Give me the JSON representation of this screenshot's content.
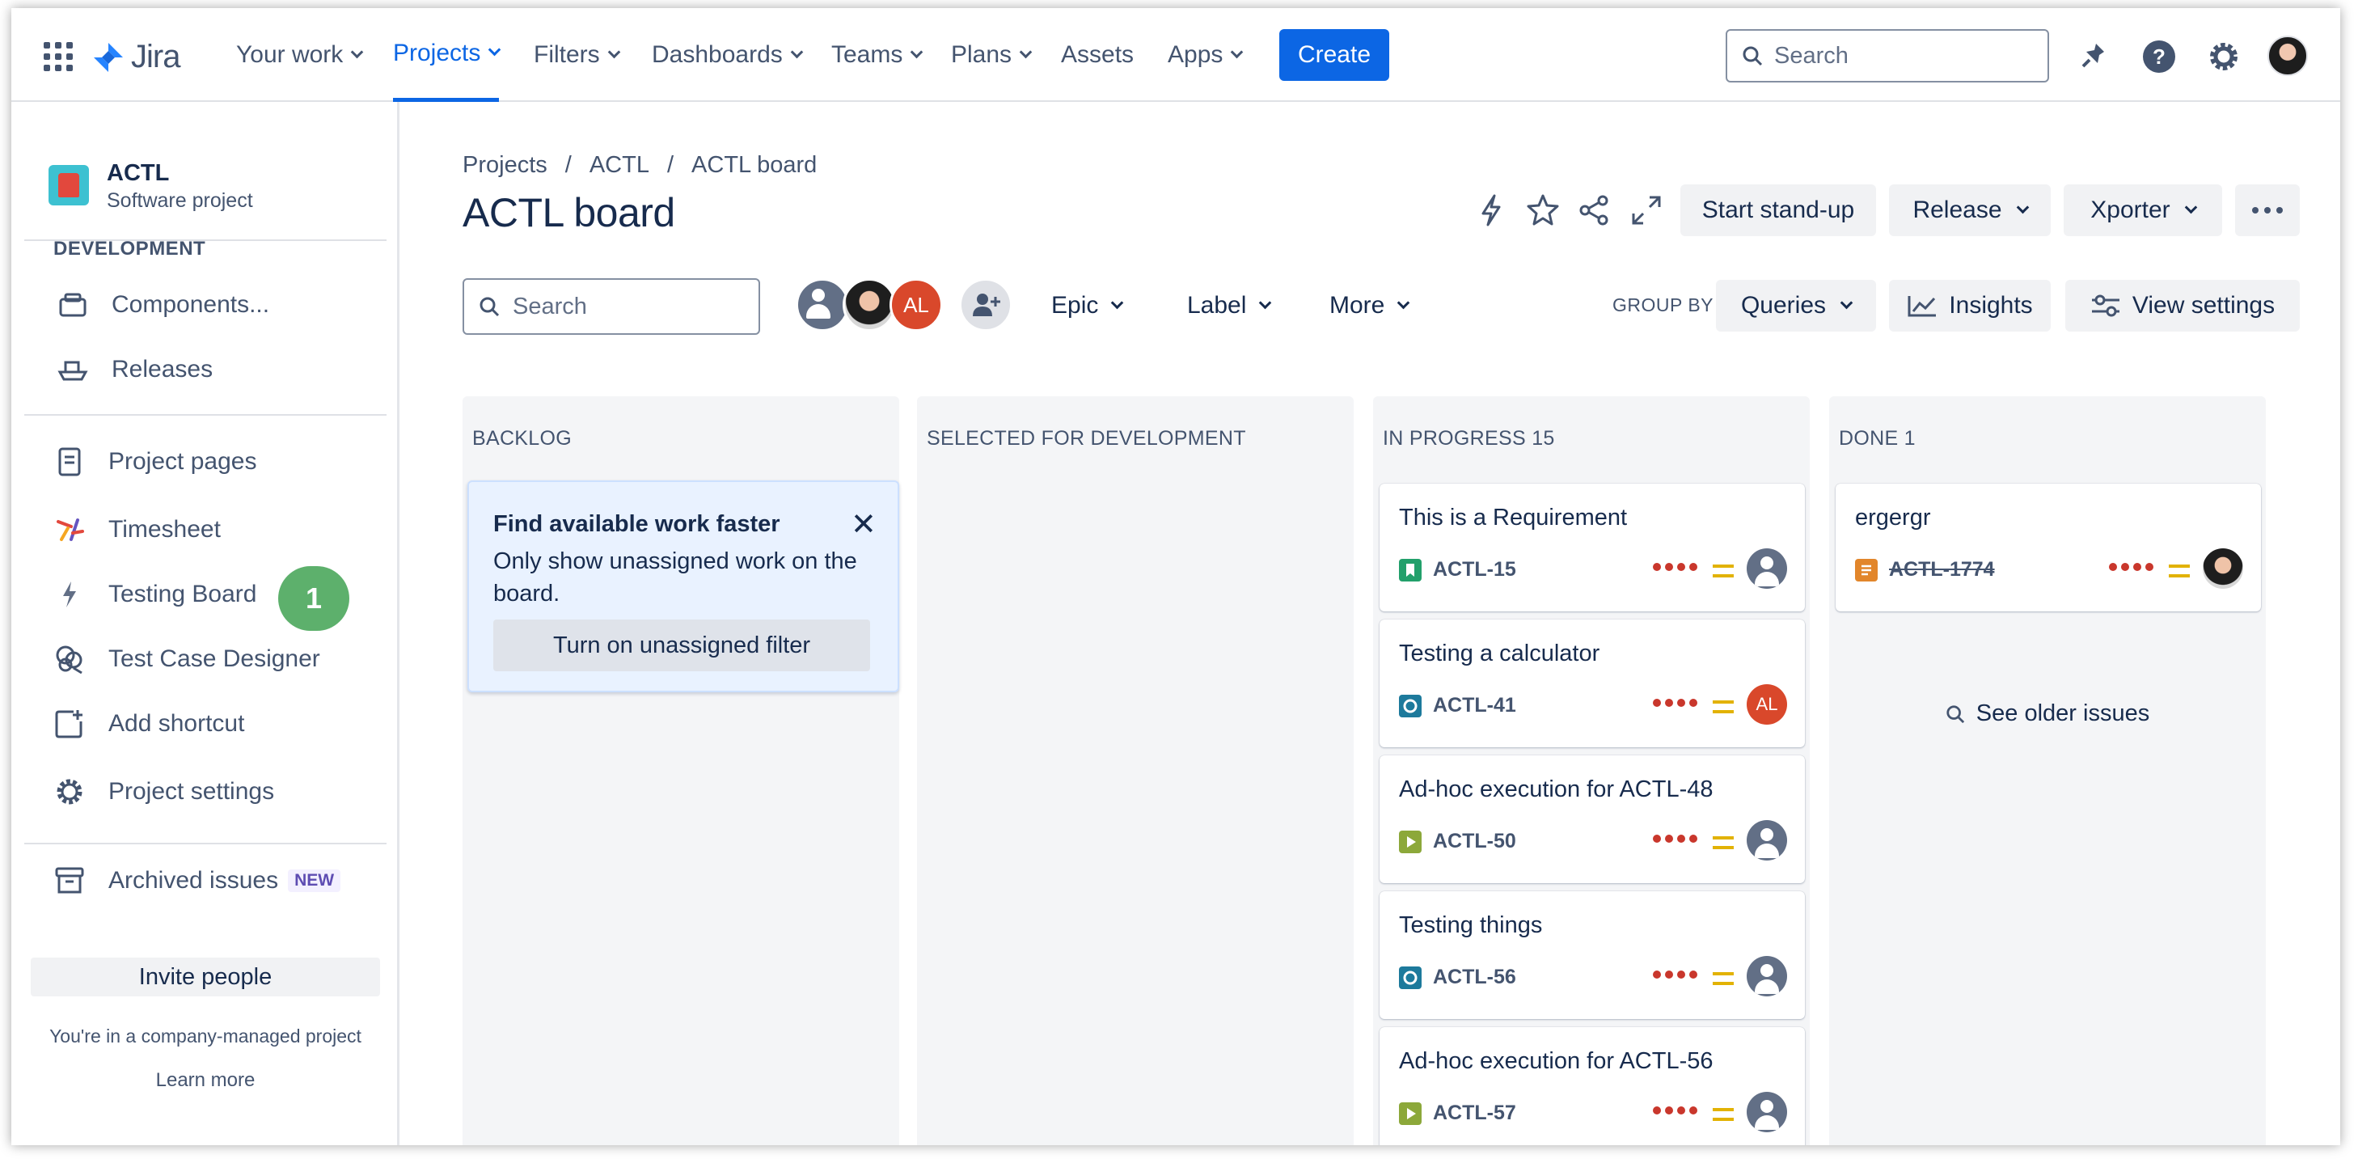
{
  "nav": {
    "logo_text": "Jira",
    "items": [
      {
        "label": "Your work"
      },
      {
        "label": "Projects"
      },
      {
        "label": "Filters"
      },
      {
        "label": "Dashboards"
      },
      {
        "label": "Teams"
      },
      {
        "label": "Plans"
      },
      {
        "label": "Assets"
      },
      {
        "label": "Apps"
      }
    ],
    "create_label": "Create",
    "search_placeholder": "Search",
    "accent_color": "#0c66e4"
  },
  "sidebar": {
    "project_name": "ACTL",
    "project_type": "Software project",
    "dev_heading": "DEVELOPMENT",
    "dev_items": [
      {
        "label": "Components...",
        "icon": "components-icon"
      },
      {
        "label": "Releases",
        "icon": "ship-icon"
      }
    ],
    "items": [
      {
        "label": "Project pages",
        "icon": "page-icon"
      },
      {
        "label": "Timesheet",
        "icon": "timesheet-icon"
      },
      {
        "label": "Testing Board",
        "icon": "lightning-icon"
      },
      {
        "label": "Test Case Designer",
        "icon": "brain-icon"
      },
      {
        "label": "Add shortcut",
        "icon": "add-shortcut-icon"
      },
      {
        "label": "Project settings",
        "icon": "gear-icon"
      }
    ],
    "badge": "1",
    "archived_label": "Archived issues",
    "new_badge": "NEW",
    "invite_label": "Invite people",
    "company_text": "You're in a company-managed project",
    "learn_more": "Learn more"
  },
  "board": {
    "breadcrumb": [
      "Projects",
      "ACTL",
      "ACTL board"
    ],
    "title": "ACTL board",
    "standup_label": "Start stand-up",
    "release_label": "Release",
    "xporter_label": "Xporter",
    "search_placeholder": "Search",
    "avatar_initials": "AL",
    "filters": [
      "Epic",
      "Label",
      "More"
    ],
    "group_by_label": "GROUP BY",
    "group_by_value": "Queries",
    "insights_label": "Insights",
    "view_settings_label": "View settings",
    "columns": [
      {
        "title": "BACKLOG"
      },
      {
        "title": "SELECTED FOR DEVELOPMENT"
      },
      {
        "title": "IN PROGRESS 15"
      },
      {
        "title": "DONE 1"
      }
    ],
    "tip": {
      "title": "Find available work faster",
      "body": "Only show unassigned work on the board.",
      "button": "Turn on unassigned filter"
    },
    "in_progress_cards": [
      {
        "title": "This is a Requirement",
        "key": "ACTL-15",
        "type_icon": "requirement-icon",
        "assignee": "unassigned"
      },
      {
        "title": "Testing a calculator",
        "key": "ACTL-41",
        "type_icon": "test-icon",
        "assignee": "AL"
      },
      {
        "title": "Ad-hoc execution for ACTL-48",
        "key": "ACTL-50",
        "type_icon": "execution-icon",
        "assignee": "unassigned"
      },
      {
        "title": "Testing things",
        "key": "ACTL-56",
        "type_icon": "test-icon",
        "assignee": "unassigned"
      },
      {
        "title": "Ad-hoc execution for ACTL-56",
        "key": "ACTL-57",
        "type_icon": "execution-icon",
        "assignee": "unassigned"
      }
    ],
    "done_cards": [
      {
        "title": "ergergr",
        "key": "ACTL-1774",
        "type_icon": "story-icon",
        "assignee": "photo"
      }
    ],
    "see_older": "See older issues"
  }
}
